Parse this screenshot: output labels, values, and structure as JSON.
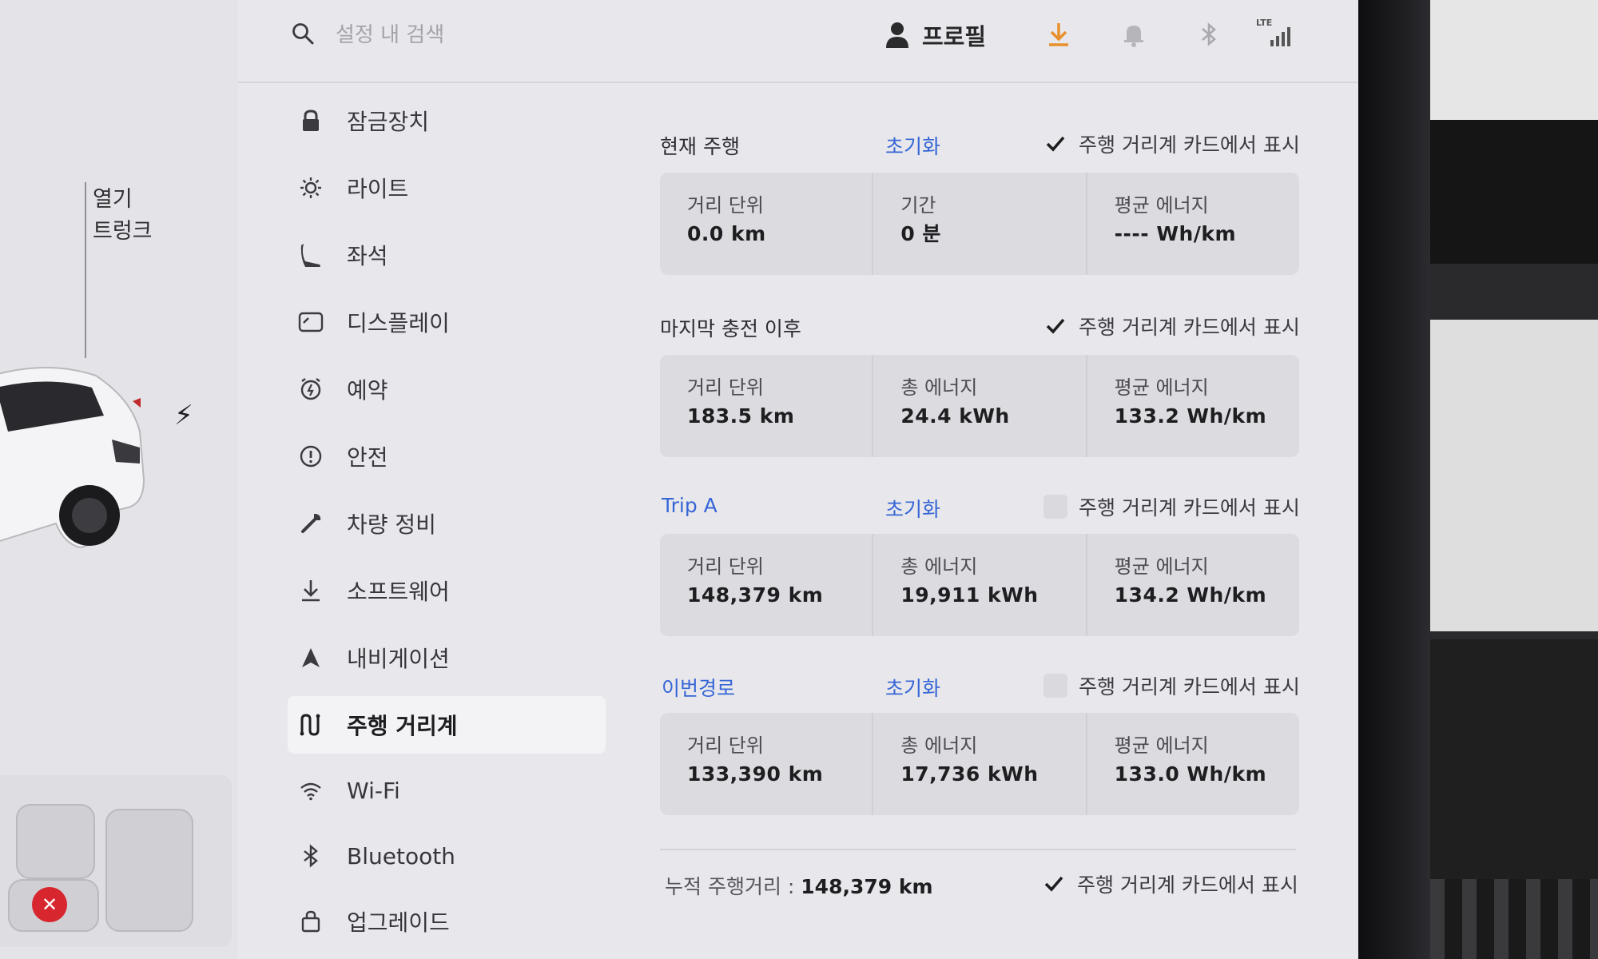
{
  "car_panel": {
    "trunk": {
      "line1": "열기",
      "line2": "트렁크"
    }
  },
  "topbar": {
    "search_placeholder": "설정 내 검색",
    "profile_label": "프로필",
    "lte_label": "LTE",
    "colors": {
      "download_accent": "#e8902c"
    }
  },
  "menu": {
    "items": [
      {
        "label": "잠금장치",
        "icon": "lock-icon"
      },
      {
        "label": "라이트",
        "icon": "sun-icon"
      },
      {
        "label": "좌석",
        "icon": "seat-icon"
      },
      {
        "label": "디스플레이",
        "icon": "display-icon"
      },
      {
        "label": "예약",
        "icon": "schedule-icon"
      },
      {
        "label": "안전",
        "icon": "alert-icon"
      },
      {
        "label": "차량 정비",
        "icon": "wrench-icon"
      },
      {
        "label": "소프트웨어",
        "icon": "download-icon"
      },
      {
        "label": "내비게이션",
        "icon": "navigation-icon"
      },
      {
        "label": "주행 거리계",
        "icon": "trips-icon",
        "active": true
      },
      {
        "label": "Wi-Fi",
        "icon": "wifi-icon"
      },
      {
        "label": "Bluetooth",
        "icon": "bluetooth-icon"
      },
      {
        "label": "업그레이드",
        "icon": "bag-icon"
      }
    ]
  },
  "trips": {
    "show_label": "주행 거리계 카드에서 표시",
    "reset_label": "초기화",
    "current": {
      "title": "현재 주행",
      "show_checked": true,
      "cells": [
        {
          "label": "거리 단위",
          "value": "0.0 km"
        },
        {
          "label": "기간",
          "value": "0 분"
        },
        {
          "label": "평균 에너지",
          "value": "---- Wh/km"
        }
      ]
    },
    "since_charge": {
      "title": "마지막 충전 이후",
      "show_checked": true,
      "cells": [
        {
          "label": "거리 단위",
          "value": "183.5 km"
        },
        {
          "label": "총 에너지",
          "value": "24.4 kWh"
        },
        {
          "label": "평균 에너지",
          "value": "133.2 Wh/km"
        }
      ]
    },
    "trip_a": {
      "title": "Trip A",
      "show_checked": false,
      "cells": [
        {
          "label": "거리 단위",
          "value": "148,379 km"
        },
        {
          "label": "총 에너지",
          "value": "19,911 kWh"
        },
        {
          "label": "평균 에너지",
          "value": "134.2 Wh/km"
        }
      ]
    },
    "this_route": {
      "title": "이번경로",
      "show_checked": false,
      "cells": [
        {
          "label": "거리 단위",
          "value": "133,390 km"
        },
        {
          "label": "총 에너지",
          "value": "17,736 kWh"
        },
        {
          "label": "평균 에너지",
          "value": "133.0 Wh/km"
        }
      ]
    },
    "odometer": {
      "label": "누적 주행거리 :",
      "value": "148,379 km",
      "show_checked": true
    }
  }
}
